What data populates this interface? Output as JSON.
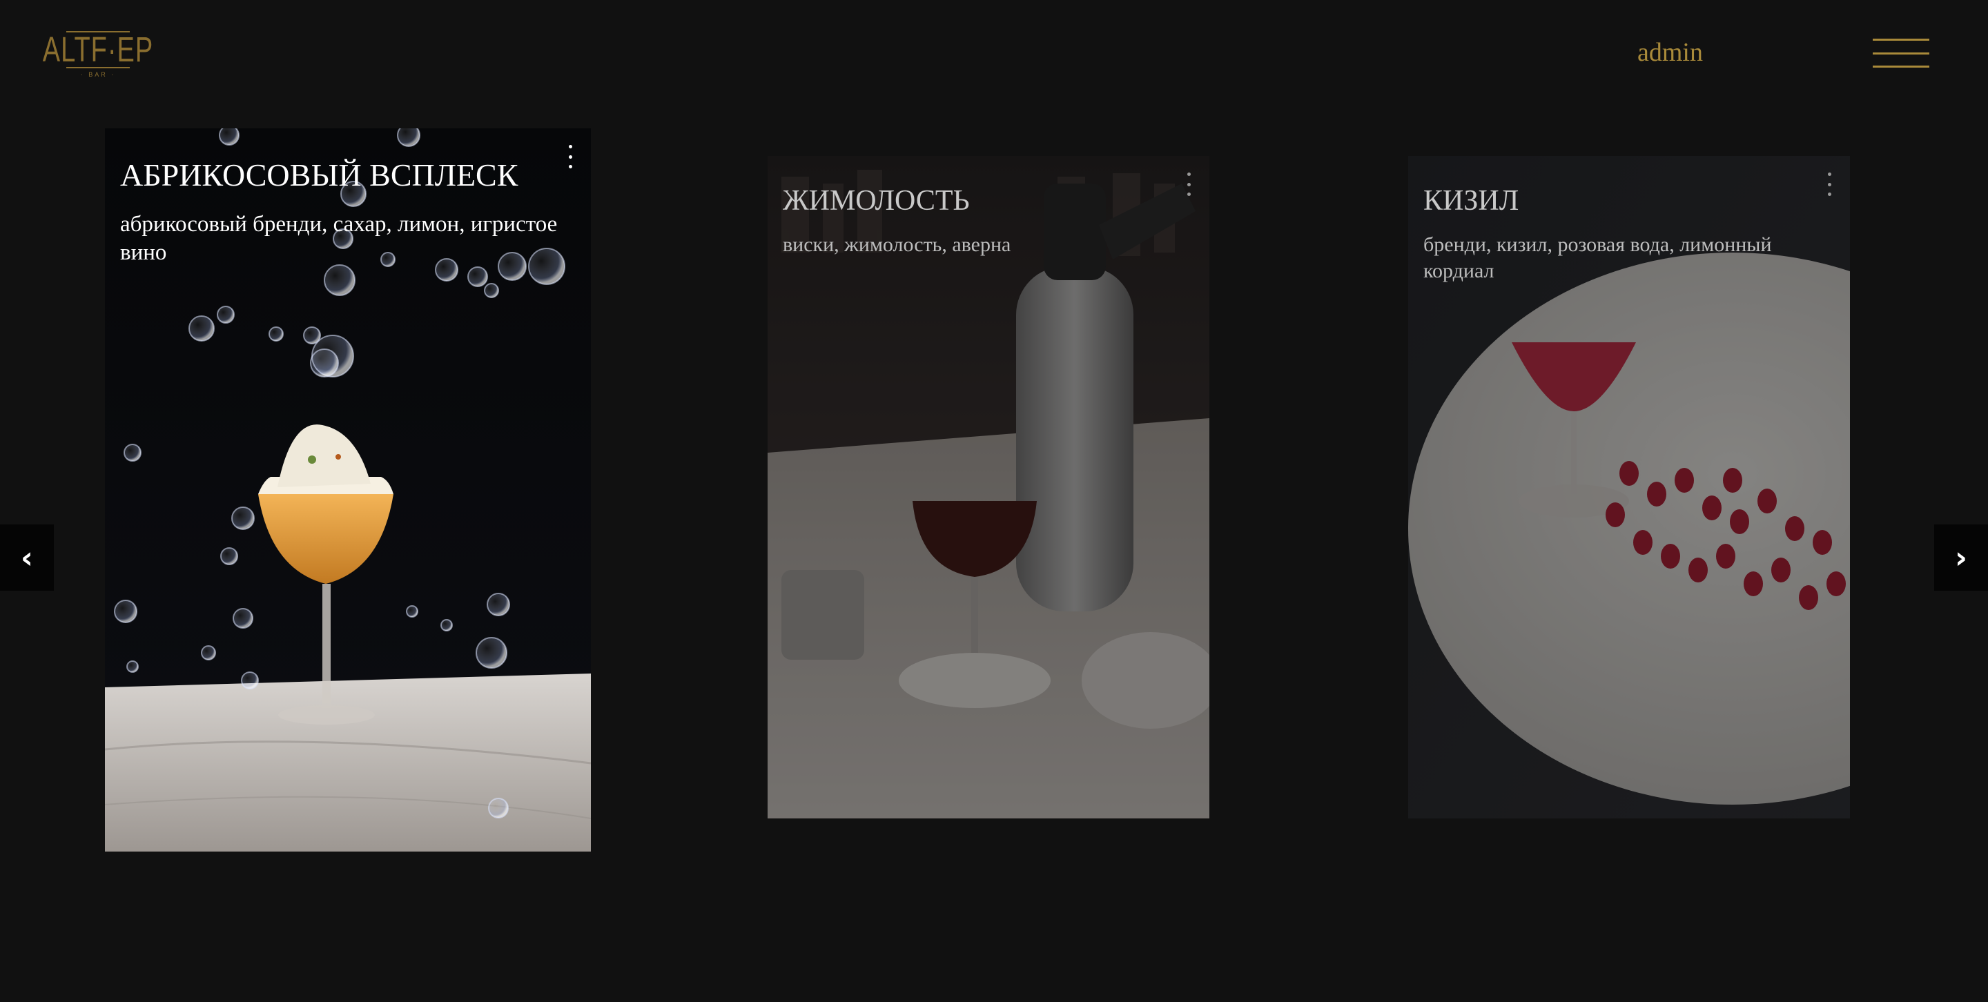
{
  "header": {
    "logo_text": "ALTF·EP",
    "logo_subtext": "· BAR ·",
    "admin_label": "admin"
  },
  "nav": {
    "prev_label": "‹",
    "next_label": "›"
  },
  "cards": [
    {
      "title": "АБРИКОСОВЫЙ ВСПЛЕСК",
      "ingredients": "абрикосовый бренди, сахар, лимон, игристое вино"
    },
    {
      "title": "ЖИМОЛОСТЬ",
      "ingredients": "виски, жимолость, аверна"
    },
    {
      "title": "КИЗИЛ",
      "ingredients": "бренди, кизил, розовая вода, лимонный кордиал"
    }
  ],
  "colors": {
    "background": "#111111",
    "accent_gold": "#a98a3a"
  }
}
